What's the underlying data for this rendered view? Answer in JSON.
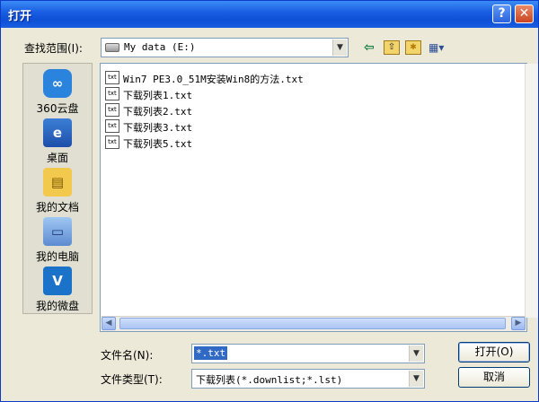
{
  "window": {
    "title": "打开"
  },
  "titlebar_buttons": {
    "help": "?",
    "close": "✕"
  },
  "lookin": {
    "label": "查找范围(I):",
    "value": "My data (E:)"
  },
  "toolbar": {
    "back": "⇦",
    "up": "⇧",
    "new_folder": "✱",
    "views": "▦▾"
  },
  "places": [
    {
      "label": "360云盘",
      "icon": "cloud-icon",
      "glyph": "∞"
    },
    {
      "label": "桌面",
      "icon": "desktop-icon",
      "glyph": "e"
    },
    {
      "label": "我的文档",
      "icon": "documents-icon",
      "glyph": "▤"
    },
    {
      "label": "我的电脑",
      "icon": "computer-icon",
      "glyph": "▭"
    },
    {
      "label": "我的微盘",
      "icon": "weipan-icon",
      "glyph": "V"
    }
  ],
  "files": [
    {
      "name": "Win7 PE3.0_51M安装Win8的方法.txt",
      "icon": "txt"
    },
    {
      "name": "下载列表1.txt",
      "icon": "txt"
    },
    {
      "name": "下载列表2.txt",
      "icon": "txt"
    },
    {
      "name": "下载列表3.txt",
      "icon": "txt"
    },
    {
      "name": "下载列表5.txt",
      "icon": "txt"
    }
  ],
  "filename": {
    "label": "文件名(N):",
    "value": "*.txt"
  },
  "filetype": {
    "label": "文件类型(T):",
    "value": "下载列表(*.downlist;*.lst)"
  },
  "buttons": {
    "open": "打开(O)",
    "cancel": "取消"
  },
  "scroll": {
    "left": "◀",
    "right": "▶"
  }
}
